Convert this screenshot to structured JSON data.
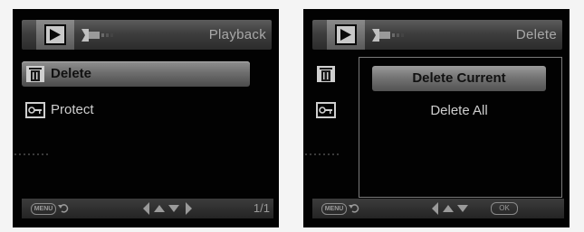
{
  "left": {
    "title": "Playback",
    "menu_items": [
      {
        "label": "Delete",
        "icon": "trash-icon",
        "selected": true
      },
      {
        "label": "Protect",
        "icon": "key-icon",
        "selected": false
      }
    ],
    "bottom": {
      "menu_label": "MENU",
      "page": "1/1"
    }
  },
  "right": {
    "title": "Delete",
    "submenu": [
      {
        "label": "Delete Current",
        "selected": true
      },
      {
        "label": "Delete All",
        "selected": false
      }
    ],
    "bottom": {
      "menu_label": "MENU",
      "ok_label": "OK"
    }
  },
  "colors": {
    "background": "#020202",
    "highlight": "#7a7a7a",
    "text": "#cfcfcf"
  }
}
